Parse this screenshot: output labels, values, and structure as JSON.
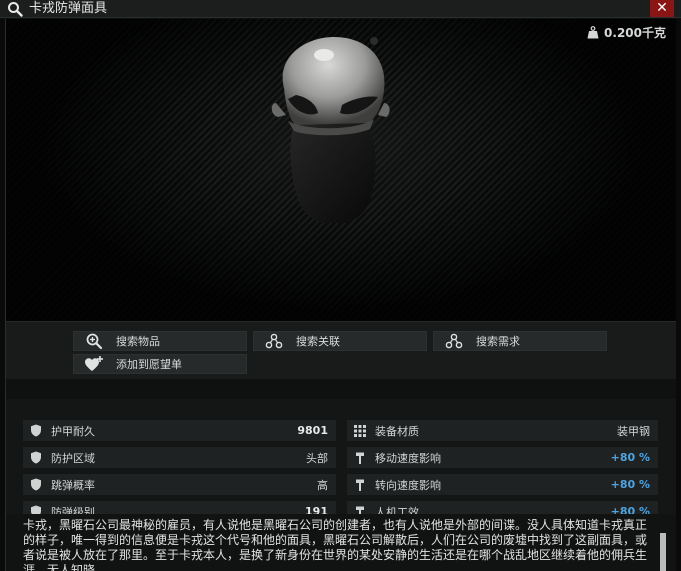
{
  "window": {
    "title": "卡戎防弹面具",
    "close_label": "✕"
  },
  "preview": {
    "weight": "0.200千克"
  },
  "actions": {
    "search_item": "搜索物品",
    "search_related": "搜索关联",
    "search_required": "搜索需求",
    "add_wishlist": "添加到愿望单"
  },
  "stats": {
    "left": [
      {
        "label": "护甲耐久",
        "value": "9801",
        "icon": "shield-icon"
      },
      {
        "label": "防护区域",
        "value": "头部",
        "icon": "shield-icon"
      },
      {
        "label": "跳弹概率",
        "value": "高",
        "icon": "shield-icon"
      },
      {
        "label": "防弹级别",
        "value": "191",
        "icon": "shield-icon"
      }
    ],
    "right": [
      {
        "label": "装备材质",
        "value": "装甲钢",
        "icon": "grid-icon"
      },
      {
        "label": "移动速度影响",
        "value": "+80 %",
        "icon": "hammer-icon"
      },
      {
        "label": "转向速度影响",
        "value": "+80 %",
        "icon": "hammer-icon"
      },
      {
        "label": "人机工效",
        "value": "+80 %",
        "icon": "hammer-icon"
      }
    ]
  },
  "description": "卡戎，黑曜石公司最神秘的雇员，有人说他是黑曜石公司的创建者，也有人说他是外部的间谍。没人具体知道卡戎真正的样子，唯一得到的信息便是卡戎这个代号和他的面具，黑曜石公司解散后，人们在公司的废墟中找到了这副面具，或者说是被人放在了那里。至于卡戎本人，是换了新身份在世界的某处安静的生活还是在哪个战乱地区继续着他的佣兵生涯，无人知晓。"
}
